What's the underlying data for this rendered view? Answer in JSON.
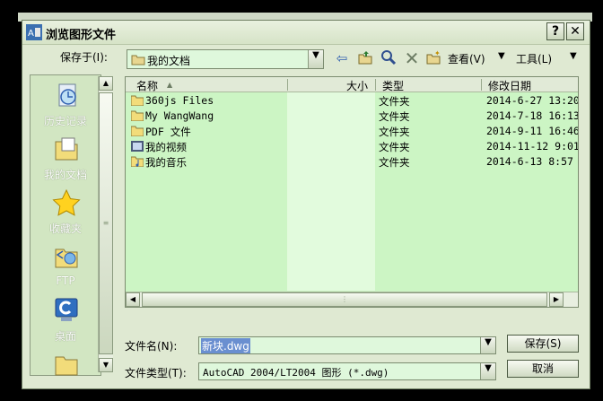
{
  "dialog": {
    "title": "浏览图形文件",
    "help_label": "?",
    "close_label": "✕"
  },
  "toolbar": {
    "save_in_label": "保存于(I):",
    "current_folder": "我的文档",
    "back_icon": "back-arrow-icon",
    "view_label": "查看(V)",
    "tools_label": "工具(L)"
  },
  "places": [
    {
      "label": "历史记录",
      "icon": "history-icon"
    },
    {
      "label": "我的文档",
      "icon": "my-documents-icon"
    },
    {
      "label": "收藏夹",
      "icon": "favorites-star-icon"
    },
    {
      "label": "FTP",
      "icon": "ftp-icon"
    },
    {
      "label": "桌面",
      "icon": "desktop-icon"
    }
  ],
  "columns": {
    "name": "名称",
    "size": "大小",
    "type": "类型",
    "modified": "修改日期"
  },
  "files": [
    {
      "name": "360js Files",
      "type": "文件夹",
      "modified": "2014-6-27 13:20",
      "icon": "folder"
    },
    {
      "name": "My WangWang",
      "type": "文件夹",
      "modified": "2014-7-18 16:13",
      "icon": "folder"
    },
    {
      "name": "PDF 文件",
      "type": "文件夹",
      "modified": "2014-9-11 16:46",
      "icon": "folder"
    },
    {
      "name": "我的视频",
      "type": "文件夹",
      "modified": "2014-11-12 9:01",
      "icon": "video-folder"
    },
    {
      "name": "我的音乐",
      "type": "文件夹",
      "modified": "2014-6-13 8:57",
      "icon": "music-folder"
    }
  ],
  "footer": {
    "filename_label": "文件名(N):",
    "filename_value": "新块.dwg",
    "filetype_label": "文件类型(T):",
    "filetype_value": "AutoCAD 2004/LT2004 图形 (*.dwg)",
    "save_button": "保存(S)",
    "cancel_button": "取消"
  },
  "colors": {
    "dialog_bg": "#dfe9d2",
    "list_bg": "#ccf5c4",
    "input_bg": "#dff8dc"
  }
}
